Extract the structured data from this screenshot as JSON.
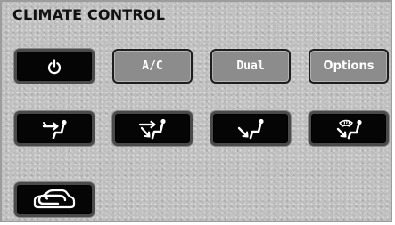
{
  "title": "CLIMATE CONTROL",
  "buttons": {
    "power": {
      "icon": "power-icon"
    },
    "ac": {
      "label": "A/C"
    },
    "dual": {
      "label": "Dual"
    },
    "options": {
      "label": "Options"
    },
    "mode_face": {
      "icon": "airflow-face-icon"
    },
    "mode_face_feet": {
      "icon": "airflow-face-feet-icon"
    },
    "mode_feet": {
      "icon": "airflow-feet-icon"
    },
    "mode_feet_defrost": {
      "icon": "airflow-feet-defrost-icon"
    },
    "recirculation": {
      "icon": "recirculation-car-icon"
    }
  },
  "colors": {
    "panel_background": "#c3c3c3",
    "active_button": "#050505",
    "inactive_button": "#8c8c8c",
    "label_text": "#ffffff"
  }
}
